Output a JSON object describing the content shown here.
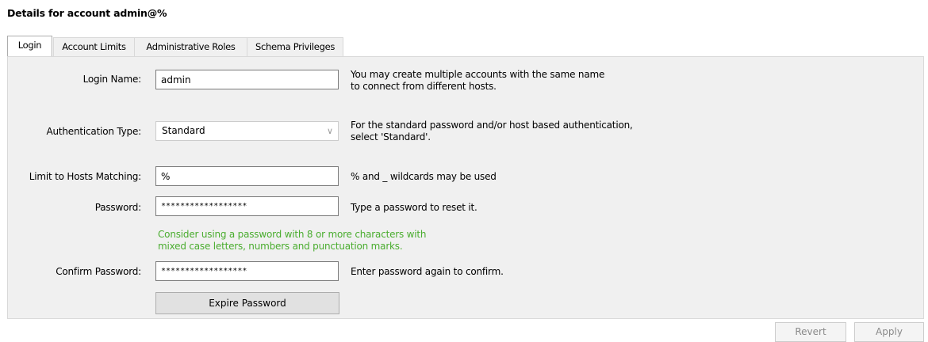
{
  "header": {
    "title": "Details for account admin@%"
  },
  "tabs": [
    {
      "label": "Login",
      "active": true
    },
    {
      "label": "Account Limits",
      "active": false
    },
    {
      "label": "Administrative Roles",
      "active": false
    },
    {
      "label": "Schema Privileges",
      "active": false
    }
  ],
  "form": {
    "login_name": {
      "label": "Login Name:",
      "value": "admin",
      "help_line1": "You may create multiple accounts with the same name",
      "help_line2": "to connect from different hosts."
    },
    "auth_type": {
      "label": "Authentication Type:",
      "value": "Standard",
      "help_line1": "For the standard password and/or host based authentication,",
      "help_line2": "select 'Standard'."
    },
    "hosts": {
      "label": "Limit to Hosts Matching:",
      "value": "%",
      "help": "% and _ wildcards may be used"
    },
    "password": {
      "label": "Password:",
      "value": "******************",
      "help": "Type a password to reset it."
    },
    "password_hint": {
      "line1": "Consider using a password with 8 or more characters with",
      "line2": "mixed case letters, numbers and punctuation marks."
    },
    "confirm": {
      "label": "Confirm Password:",
      "value": "******************",
      "help": "Enter password again to confirm."
    },
    "expire_button": "Expire Password"
  },
  "footer": {
    "revert_label": "Revert",
    "apply_label": "Apply"
  },
  "colors": {
    "hint_green": "#4aad2f",
    "panel_bg": "#f0f0f0",
    "disabled_text": "#8a8a8a"
  },
  "icons": {
    "select_arrow": "chevron-down-icon"
  }
}
